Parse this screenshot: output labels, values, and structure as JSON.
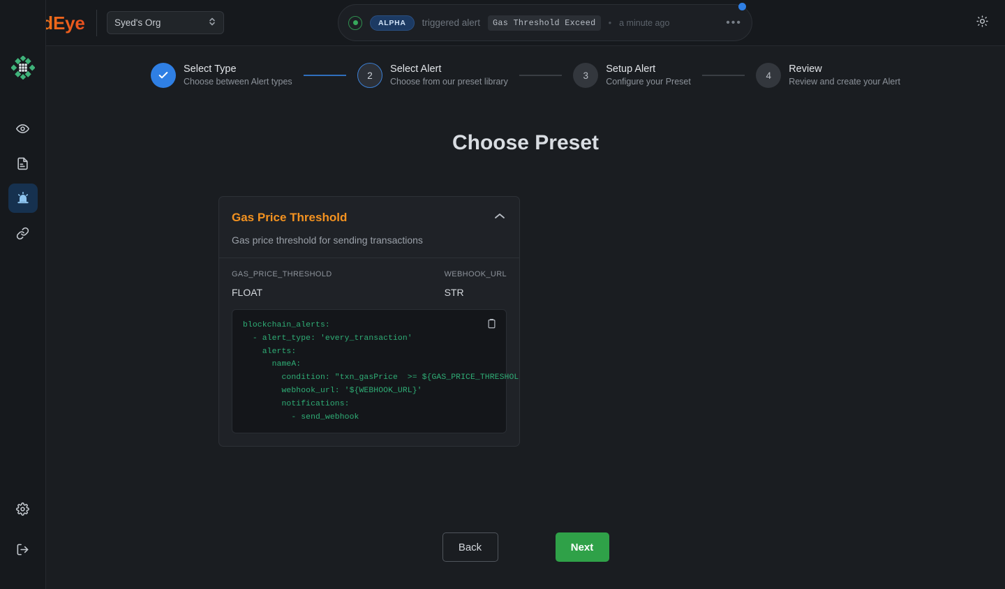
{
  "brand": {
    "name": "ThirdEye"
  },
  "org_selector": {
    "value": "Syed's Org",
    "icon": "chevron-up-down-icon"
  },
  "alert_banner": {
    "status_icon": "green-dot-icon",
    "env_badge": "ALPHA",
    "action_text": "triggered alert",
    "alert_name": "Gas Threshold Exceed",
    "separator": "•",
    "timestamp": "a minute ago",
    "menu_icon": "ellipsis-icon",
    "unread_badge": true
  },
  "theme_toggle": {
    "icon": "sun-icon"
  },
  "sidebar": {
    "logo": "diamond-grid-logo",
    "items": [
      {
        "id": "observability",
        "icon": "eye-icon",
        "active": false
      },
      {
        "id": "reports",
        "icon": "document-icon",
        "active": false
      },
      {
        "id": "alerts",
        "icon": "siren-icon",
        "active": true
      },
      {
        "id": "integrations",
        "icon": "link-icon",
        "active": false
      }
    ],
    "bottom_items": [
      {
        "id": "settings",
        "icon": "gear-icon"
      },
      {
        "id": "logout",
        "icon": "logout-icon"
      }
    ]
  },
  "stepper": {
    "steps": [
      {
        "number": "1",
        "state": "done",
        "marker": "✓",
        "title": "Select Type",
        "subtitle": "Choose between Alert types"
      },
      {
        "number": "2",
        "state": "current",
        "marker": "2",
        "title": "Select Alert",
        "subtitle": "Choose from our preset library"
      },
      {
        "number": "3",
        "state": "todo",
        "marker": "3",
        "title": "Setup Alert",
        "subtitle": "Configure your Preset"
      },
      {
        "number": "4",
        "state": "todo",
        "marker": "4",
        "title": "Review",
        "subtitle": "Review and create your Alert"
      }
    ]
  },
  "main": {
    "page_title": "Choose Preset",
    "preset": {
      "name": "Gas Price Threshold",
      "description": "Gas price threshold for sending transactions",
      "collapse_icon": "chevron-up-icon",
      "params": [
        {
          "key": "GAS_PRICE_THRESHOLD",
          "type": "FLOAT"
        },
        {
          "key": "WEBHOOK_URL",
          "type": "STR"
        }
      ],
      "code": "blockchain_alerts:\n  - alert_type: 'every_transaction'\n    alerts:\n      nameA:\n        condition: \"txn_gasPrice  >= ${GAS_PRICE_THRESHOLD}\"\n        webhook_url: '${WEBHOOK_URL}'\n        notifications:\n          - send_webhook",
      "copy_icon": "clipboard-icon"
    }
  },
  "footer": {
    "back_label": "Back",
    "next_label": "Next"
  },
  "colors": {
    "brand_orange": "#ee7722",
    "accent_blue": "#2f7fe4",
    "success_green": "#2fa148",
    "code_green": "#2fae76",
    "preset_title": "#f39220",
    "page_bg": "#1a1d21",
    "panel_bg": "#16191d"
  }
}
